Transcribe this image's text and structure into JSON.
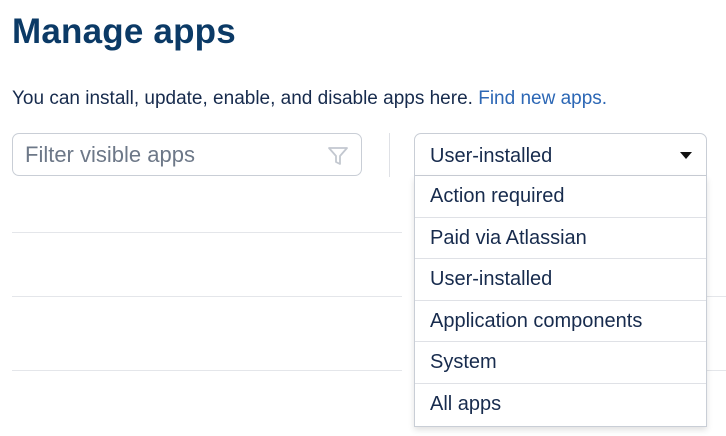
{
  "page": {
    "title": "Manage apps",
    "intro_text": "You can install, update, enable, and disable apps here. ",
    "intro_link": "Find new apps."
  },
  "filter": {
    "placeholder": "Filter visible apps",
    "icon": "funnel-icon"
  },
  "app_type_select": {
    "selected": "User-installed",
    "icon": "caret-down-icon",
    "options": [
      "Action required",
      "Paid via Atlassian",
      "User-installed",
      "Application components",
      "System",
      "All apps"
    ]
  },
  "colors": {
    "title": "#0b3a66",
    "link": "#2c67b5",
    "border": "#c9ced6"
  }
}
